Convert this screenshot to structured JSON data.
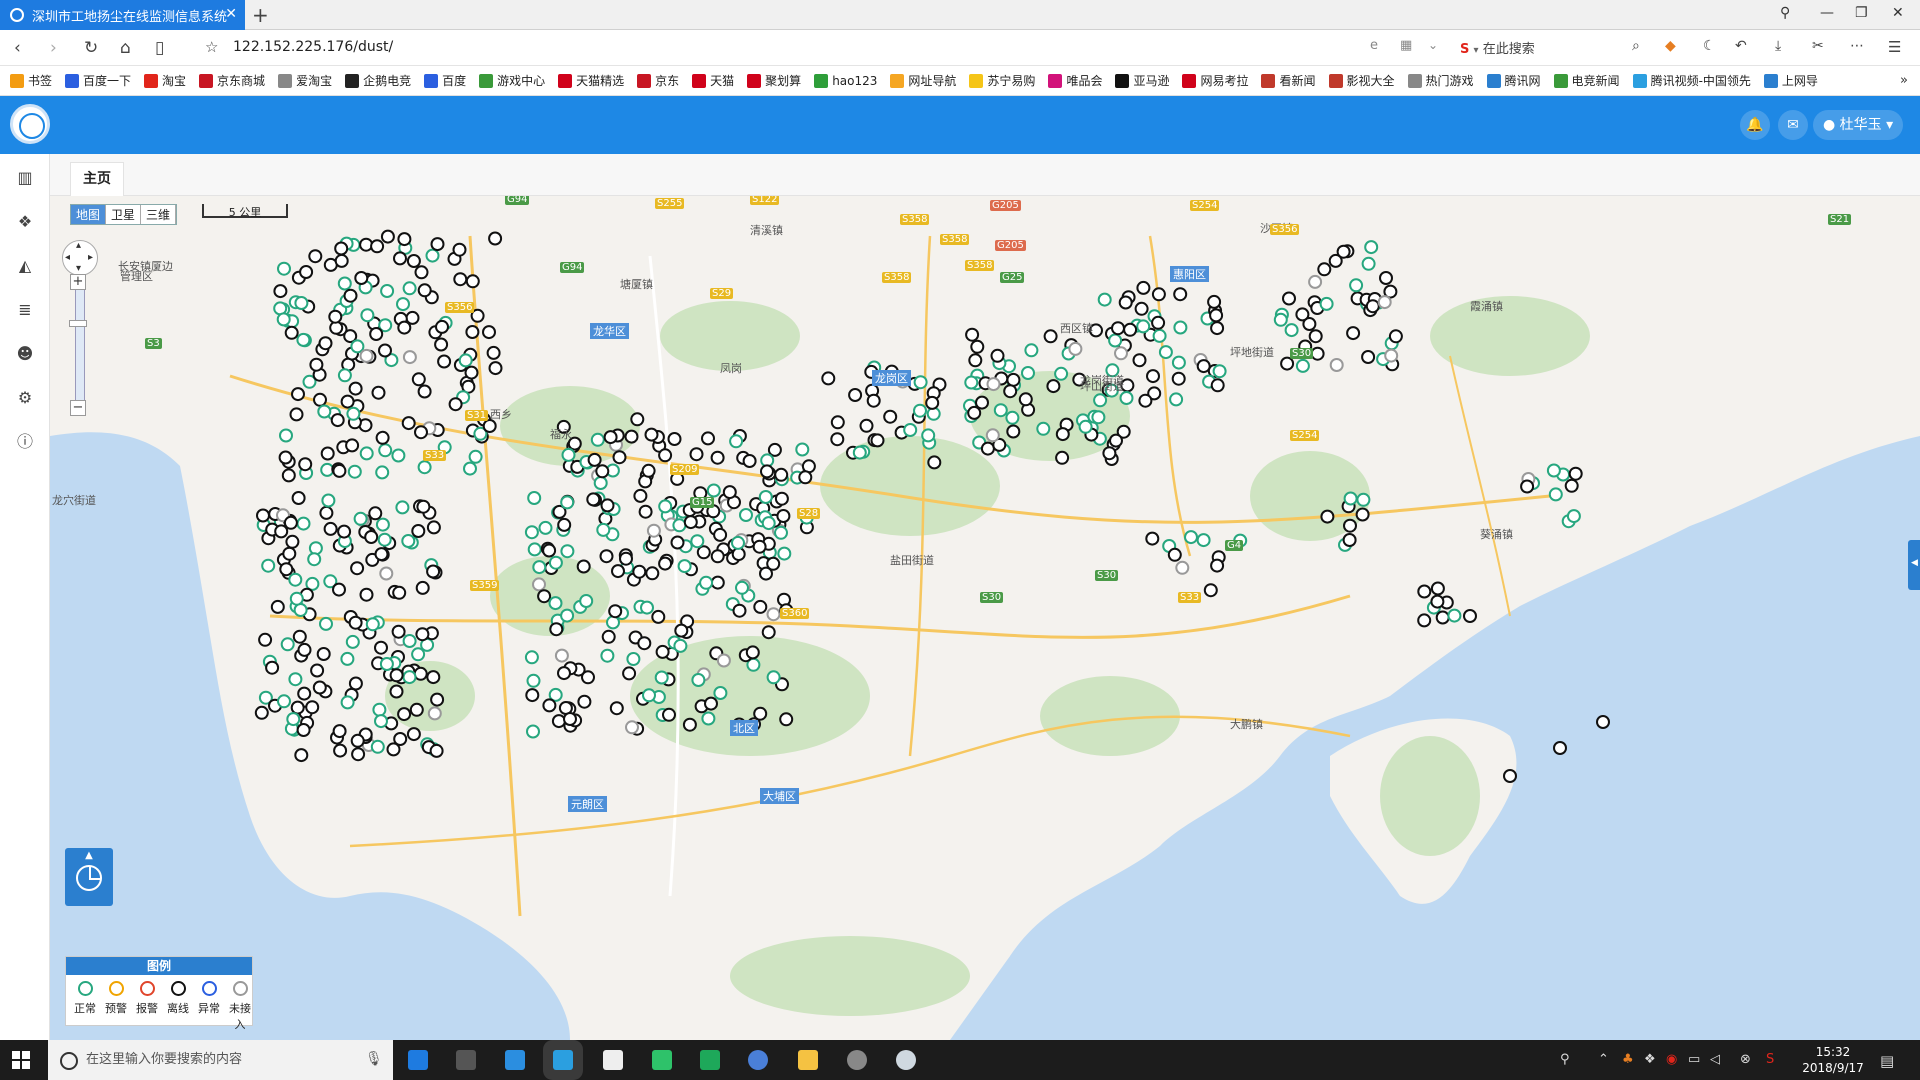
{
  "browser": {
    "tab_title": "深圳市工地扬尘在线监测信息系统",
    "new_tab": "+",
    "url": "122.152.225.176/dust/",
    "search_placeholder": "在此搜索"
  },
  "bookmarks": [
    {
      "label": "书签",
      "color": "#f39c12",
      "icon": "star-icon"
    },
    {
      "label": "百度一下",
      "color": "#2b5fe0",
      "icon": "paw-icon"
    },
    {
      "label": "淘宝",
      "color": "#e1251b",
      "icon": "taobao-icon"
    },
    {
      "label": "京东商城",
      "color": "#c81623",
      "icon": "jd-icon"
    },
    {
      "label": "爱淘宝",
      "color": "#888888",
      "icon": "globe-icon"
    },
    {
      "label": "企鹅电竞",
      "color": "#222222",
      "icon": "penguin-icon"
    },
    {
      "label": "百度",
      "color": "#2b5fe0",
      "icon": "paw-icon"
    },
    {
      "label": "游戏中心",
      "color": "#3a9a3a",
      "icon": "gamepad-icon"
    },
    {
      "label": "天猫精选",
      "color": "#d0021b",
      "icon": "tmall-icon"
    },
    {
      "label": "京东",
      "color": "#c81623",
      "icon": "jd-icon"
    },
    {
      "label": "天猫",
      "color": "#d0021b",
      "icon": "tmall-icon"
    },
    {
      "label": "聚划算",
      "color": "#d0021b",
      "icon": "jhs-icon"
    },
    {
      "label": "hao123",
      "color": "#2e9e3a",
      "icon": "hao123-icon"
    },
    {
      "label": "网址导航",
      "color": "#f5a623",
      "icon": "nav-icon"
    },
    {
      "label": "苏宁易购",
      "color": "#f5c518",
      "icon": "suning-icon"
    },
    {
      "label": "唯品会",
      "color": "#d2127a",
      "icon": "vip-icon"
    },
    {
      "label": "亚马逊",
      "color": "#111111",
      "icon": "amazon-icon"
    },
    {
      "label": "网易考拉",
      "color": "#d0021b",
      "icon": "kaola-icon"
    },
    {
      "label": "看新闻",
      "color": "#c0392b",
      "icon": "news-icon"
    },
    {
      "label": "影视大全",
      "color": "#c0392b",
      "icon": "play-icon"
    },
    {
      "label": "热门游戏",
      "color": "#888888",
      "icon": "globe-icon"
    },
    {
      "label": "腾讯网",
      "color": "#2b7fcf",
      "icon": "tencent-icon"
    },
    {
      "label": "电竞新闻",
      "color": "#3a9a3a",
      "icon": "esports-icon"
    },
    {
      "label": "腾讯视频-中国领先",
      "color": "#2b9fe0",
      "icon": "video-icon"
    },
    {
      "label": "上网导",
      "color": "#2b7fcf",
      "icon": "e-icon"
    }
  ],
  "header": {
    "user": "杜华玉",
    "bell": "🔔",
    "mail": "✉"
  },
  "sidebar_icons": [
    "map-icon",
    "layers-icon",
    "chart-icon",
    "data-icon",
    "users-icon",
    "settings-icon",
    "info-icon"
  ],
  "tabs": {
    "home": "主页"
  },
  "map": {
    "map_types": [
      {
        "label": "地图",
        "active": true
      },
      {
        "label": "卫星",
        "active": false
      },
      {
        "label": "三维",
        "active": false
      }
    ],
    "scale": "5 公里",
    "zoom_in": "+",
    "zoom_out": "−",
    "labels": [
      {
        "text": "清溪镇"
      },
      {
        "text": "塘厦镇"
      },
      {
        "text": "凤岗"
      },
      {
        "text": "长安镇厦边"
      },
      {
        "text": "管理区"
      },
      {
        "text": "龙穴街道"
      },
      {
        "text": "坪地街道"
      },
      {
        "text": "西区镇"
      },
      {
        "text": "霞涌镇"
      },
      {
        "text": "坪山街道"
      },
      {
        "text": "沙田镇"
      },
      {
        "text": "葵涌镇"
      },
      {
        "text": "龙岗街道"
      },
      {
        "text": "盐田街道"
      },
      {
        "text": "大鹏镇"
      },
      {
        "text": "西乡"
      },
      {
        "text": "福永"
      }
    ],
    "districts": [
      {
        "text": "惠阳区"
      },
      {
        "text": "龙华区"
      },
      {
        "text": "龙岗区"
      },
      {
        "text": "北区"
      },
      {
        "text": "元朗区"
      },
      {
        "text": "大埔区"
      }
    ],
    "roads": [
      {
        "text": "G94",
        "c": "rg"
      },
      {
        "text": "S255",
        "c": "ry"
      },
      {
        "text": "S122",
        "c": "ry"
      },
      {
        "text": "S358",
        "c": "ry"
      },
      {
        "text": "G205",
        "c": "rr"
      },
      {
        "text": "S254",
        "c": "ry"
      },
      {
        "text": "S356",
        "c": "ry"
      },
      {
        "text": "S21",
        "c": "rg"
      },
      {
        "text": "S358",
        "c": "ry"
      },
      {
        "text": "G205",
        "c": "rr"
      },
      {
        "text": "S358",
        "c": "ry"
      },
      {
        "text": "S358",
        "c": "ry"
      },
      {
        "text": "G25",
        "c": "rg"
      },
      {
        "text": "G94",
        "c": "rg"
      },
      {
        "text": "S29",
        "c": "ry"
      },
      {
        "text": "S356",
        "c": "ry"
      },
      {
        "text": "S3",
        "c": "rg"
      },
      {
        "text": "S30",
        "c": "rg"
      },
      {
        "text": "S31",
        "c": "ry"
      },
      {
        "text": "S33",
        "c": "ry"
      },
      {
        "text": "S359",
        "c": "ry"
      },
      {
        "text": "S209",
        "c": "ry"
      },
      {
        "text": "G15",
        "c": "rg"
      },
      {
        "text": "S28",
        "c": "ry"
      },
      {
        "text": "S254",
        "c": "ry"
      },
      {
        "text": "S30",
        "c": "rg"
      },
      {
        "text": "S30",
        "c": "rg"
      },
      {
        "text": "S360",
        "c": "ry"
      },
      {
        "text": "S33",
        "c": "ry"
      },
      {
        "text": "G4",
        "c": "rg"
      }
    ],
    "dense_counts": {
      "normal": 230,
      "offline": 420,
      "abnormal": 0,
      "warning": 0,
      "alarm": 0,
      "none": 25
    }
  },
  "stat_button": {
    "arrow": "▲"
  },
  "legend": {
    "title": "图例",
    "items": [
      {
        "label": "正常",
        "color": "#27a77f"
      },
      {
        "label": "预警",
        "color": "#f0a400"
      },
      {
        "label": "报警",
        "color": "#e0452b"
      },
      {
        "label": "离线",
        "color": "#111111"
      },
      {
        "label": "异常",
        "color": "#2b5fe0"
      },
      {
        "label": "未接入",
        "color": "#999999"
      }
    ]
  },
  "taskbar": {
    "search_placeholder": "在这里输入你要搜索的内容",
    "time": "15:32",
    "date": "2018/9/17"
  }
}
